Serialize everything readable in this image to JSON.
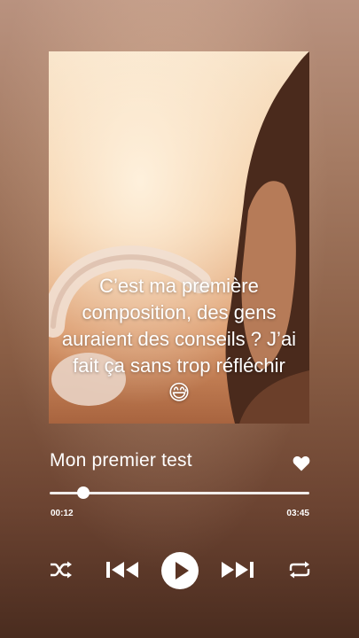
{
  "post": {
    "caption_line1": "C’est ma première",
    "caption_line2": "composition, des gens",
    "caption_line3": "auraient des conseils ? J’ai",
    "caption_line4": "fait ça sans trop réfléchir",
    "caption_emoji": "😅"
  },
  "player": {
    "song_title": "Mon premier test",
    "elapsed_time": "00:12",
    "total_time": "03:45",
    "progress": 0.13,
    "liked": true
  },
  "icons": {
    "like": "heart-icon",
    "shuffle": "shuffle-icon",
    "previous": "previous-icon",
    "play": "play-icon",
    "next": "next-icon",
    "repeat": "repeat-icon"
  },
  "colors": {
    "accent": "#ffffff",
    "background_top": "#b9927f",
    "background_bottom": "#4a2c1f"
  }
}
